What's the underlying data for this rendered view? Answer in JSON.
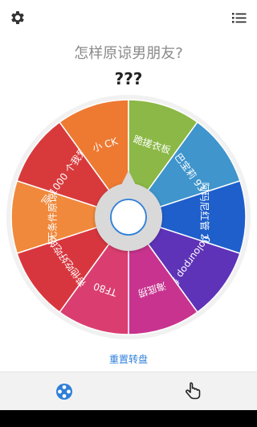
{
  "header": {
    "settings_icon": "gear-icon",
    "list_icon": "list-icon"
  },
  "question": "怎样原谅男朋友?",
  "result": "???",
  "wheel": {
    "segments": [
      {
        "label": "无条件原谅",
        "color": "#F0893C"
      },
      {
        "label": "写 1000 个我爱你",
        "color": "#D83A3C"
      },
      {
        "label": "小 CK",
        "color": "#EE7A32"
      },
      {
        "label": "跪搓衣板",
        "color": "#8BB846"
      },
      {
        "label": "巴宝莉 93",
        "color": "#3F95CC"
      },
      {
        "label": "阿玛尼红管 201",
        "color": "#1E5FCB"
      },
      {
        "label": "Colourpop 盘",
        "color": "#5E33B8"
      },
      {
        "label": "海底捞",
        "color": "#C8338F"
      },
      {
        "label": "TF80",
        "color": "#DA3E70"
      },
      {
        "label": "带他吃好吃的",
        "color": "#D8363E"
      }
    ]
  },
  "reset_label": "重置转盘",
  "bottom_tabs": [
    {
      "icon": "wheel-icon",
      "active_color": "#2F7FD8"
    },
    {
      "icon": "hand-tap-icon"
    }
  ]
}
